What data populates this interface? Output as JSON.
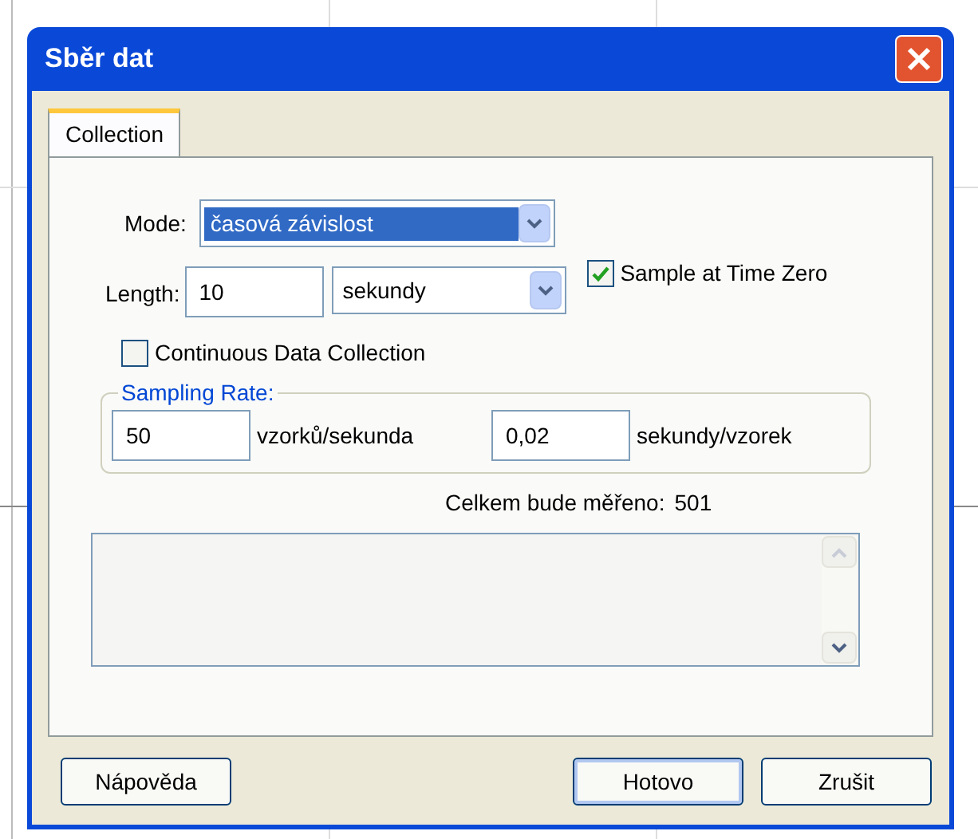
{
  "window": {
    "title": "Sběr dat"
  },
  "tabs": [
    {
      "label": "Collection",
      "selected": true
    }
  ],
  "mode": {
    "label": "Mode:",
    "value": "časová závislost"
  },
  "length": {
    "label": "Length:",
    "value": "10",
    "unit": "sekundy"
  },
  "sample_at_time_zero": {
    "label": "Sample at Time Zero",
    "checked": true
  },
  "continuous": {
    "label": "Continuous Data Collection",
    "checked": false
  },
  "sampling_rate": {
    "legend": "Sampling Rate:",
    "rate": {
      "value": "50",
      "unit": "vzorků/sekunda"
    },
    "interval": {
      "value": "0,02",
      "unit": "sekundy/vzorek"
    }
  },
  "total": {
    "label": "Celkem bude měřeno:",
    "value": "501"
  },
  "buttons": [
    {
      "label": "Nápověda",
      "default": false
    },
    {
      "label": "Hotovo",
      "default": true
    },
    {
      "label": "Zrušit",
      "default": false
    }
  ]
}
